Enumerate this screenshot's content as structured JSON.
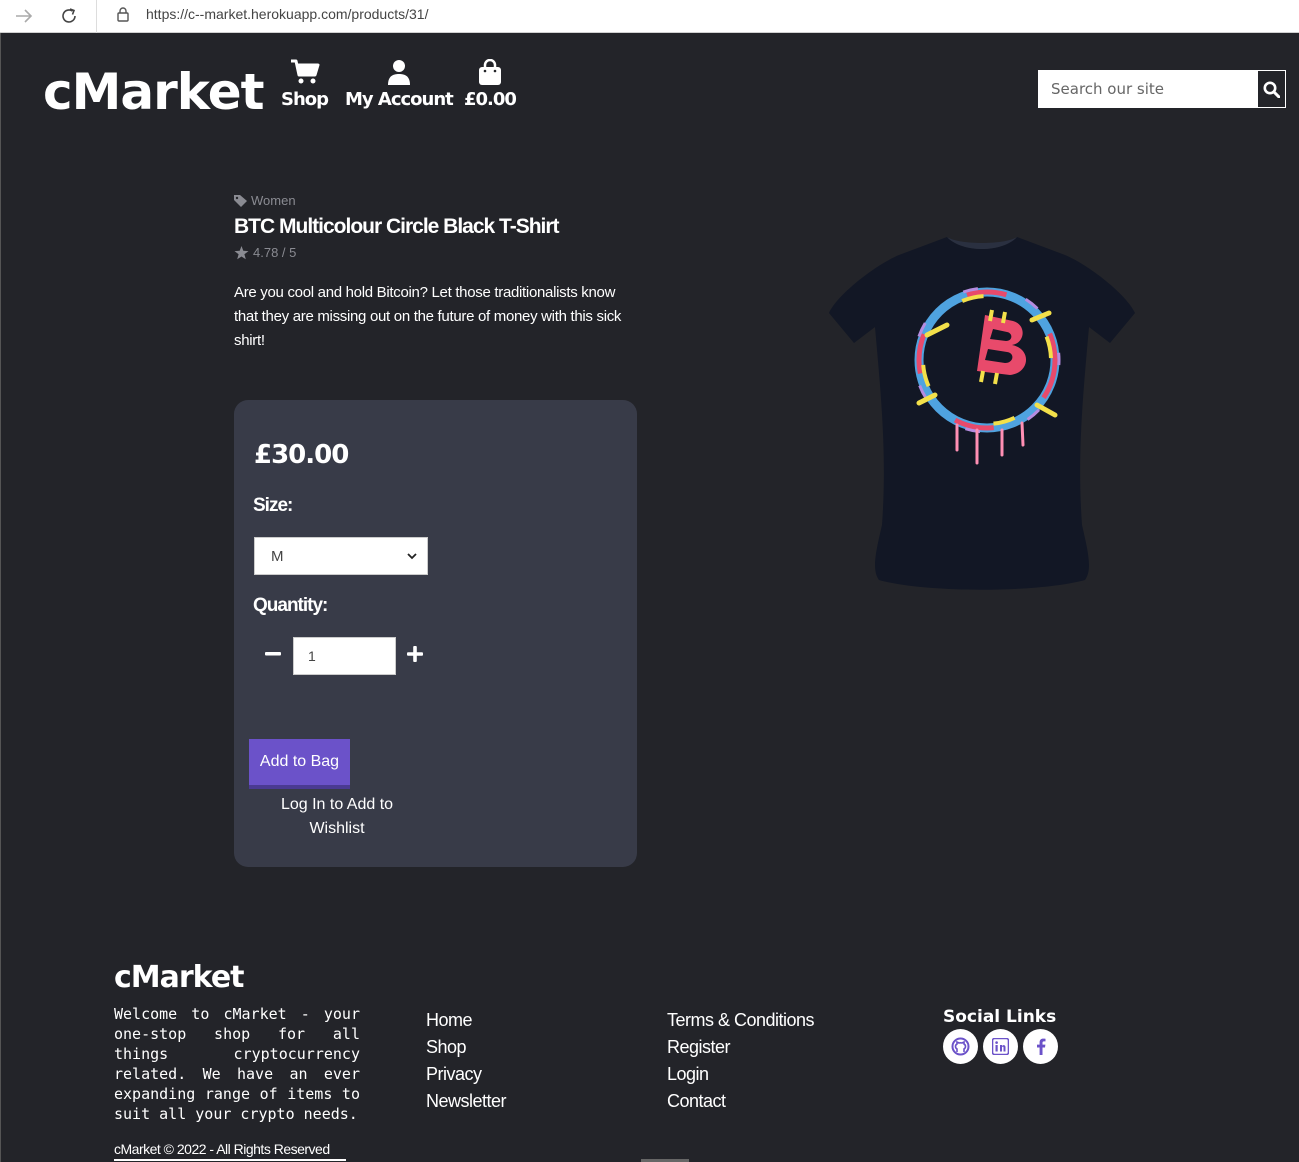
{
  "browser": {
    "url": "https://c--market.herokuapp.com/products/31/"
  },
  "header": {
    "logo": "cMarket",
    "nav": {
      "shop": "Shop",
      "account": "My Account",
      "bag_total": "£0.00"
    },
    "search": {
      "placeholder": "Search our site"
    }
  },
  "product": {
    "category": "Women",
    "title": "BTC Multicolour Circle Black T-Shirt",
    "rating": "4.78 / 5",
    "description": "Are you cool and hold Bitcoin? Let those traditionalists know that they are missing out on the future of money with this sick shirt!",
    "price": "£30.00",
    "size_label": "Size:",
    "size_selected": "M",
    "quantity_label": "Quantity:",
    "quantity_value": "1",
    "add_to_bag": "Add to Bag",
    "wishlist_text": "Log In to Add to Wishlist"
  },
  "footer": {
    "logo": "cMarket",
    "about": "Welcome to cMarket - your one-stop shop for all things cryptocurrency related. We have an ever expanding range of items to suit all your crypto needs.",
    "col1": [
      "Home",
      "Shop",
      "Privacy",
      "Newsletter"
    ],
    "col2": [
      "Terms & Conditions",
      "Register",
      "Login",
      "Contact"
    ],
    "social_title": "Social Links",
    "social_icons": [
      "github-icon",
      "linkedin-icon",
      "facebook-icon"
    ],
    "copyright": "cMarket © 2022 - All Rights Reserved"
  },
  "colors": {
    "background": "#232429",
    "panel": "#383b48",
    "accent": "#6b52c9"
  }
}
